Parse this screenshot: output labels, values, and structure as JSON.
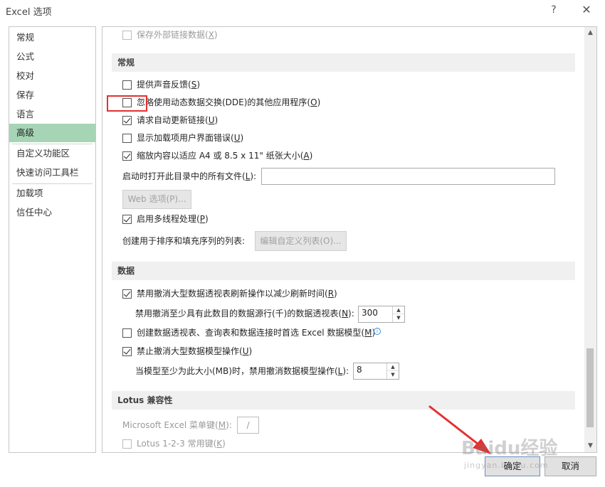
{
  "window": {
    "title": "Excel 选项",
    "help_glyph": "?",
    "close_glyph": "✕"
  },
  "nav": {
    "items": [
      {
        "label": "常规"
      },
      {
        "label": "公式"
      },
      {
        "label": "校对"
      },
      {
        "label": "保存"
      },
      {
        "label": "语言"
      },
      {
        "label": "高级"
      },
      {
        "label": "自定义功能区"
      },
      {
        "label": "快速访问工具栏"
      },
      {
        "label": "加载项"
      },
      {
        "label": "信任中心"
      }
    ],
    "active": "高级"
  },
  "content": {
    "top_option": {
      "pre": "保存外部链接数据(",
      "key": "X",
      "post": ")",
      "checked": false,
      "enabled": false
    },
    "general": {
      "header": "常规",
      "options": [
        {
          "pre": "提供声音反馈(",
          "key": "S",
          "post": ")",
          "checked": false
        },
        {
          "pre": "忽略使用动态数据交换(DDE)的其他应用程序(",
          "key": "O",
          "post": ")",
          "checked": false
        },
        {
          "pre": "请求自动更新链接(",
          "key": "U",
          "post": ")",
          "checked": true
        },
        {
          "pre": "显示加载项用户界面错误(",
          "key": "U",
          "post": ")",
          "checked": false
        },
        {
          "pre": "缩放内容以适应 A4 或 8.5 x 11\" 纸张大小(",
          "key": "A",
          "post": ")",
          "checked": true
        }
      ],
      "startup_label_pre": "启动时打开此目录中的所有文件(",
      "startup_label_key": "L",
      "startup_label_post": "):",
      "startup_value": "",
      "web_options_button": "Web 选项(P)...",
      "multithread": {
        "pre": "启用多线程处理(",
        "key": "P",
        "post": ")",
        "checked": true
      },
      "custom_list_label": "创建用于排序和填充序列的列表:",
      "custom_list_button": "编辑自定义列表(O)..."
    },
    "data": {
      "header": "数据",
      "disable_undo_pivot": {
        "pre": "禁用撤消大型数据透视表刷新操作以减少刷新时间(",
        "key": "R",
        "post": ")",
        "checked": true
      },
      "pivot_rows_label_pre": "禁用撤消至少具有此数目的数据源行(千)的数据透视表(",
      "pivot_rows_label_key": "N",
      "pivot_rows_label_post": "):",
      "pivot_rows_value": "300",
      "default_model": {
        "pre": "创建数据透视表、查询表和数据连接时首选 Excel 数据模型(",
        "key": "M",
        "post": ")",
        "checked": false
      },
      "info_glyph": "i",
      "disable_undo_model": {
        "pre": "禁止撤消大型数据模型操作(",
        "key": "U",
        "post": ")",
        "checked": true
      },
      "model_size_label_pre": "当模型至少为此大小(MB)时，禁用撤消数据模型操作(",
      "model_size_label_key": "L",
      "model_size_label_post": "):",
      "model_size_value": "8"
    },
    "lotus": {
      "header": "Lotus 兼容性",
      "menu_key_label_pre": "Microsoft Excel 菜单键(",
      "menu_key_label_key": "M",
      "menu_key_label_post": "):",
      "menu_key_value": "/",
      "lotus_keys": {
        "pre": "Lotus 1-2-3 常用键(",
        "key": "K",
        "post": ")",
        "checked": false,
        "enabled": false
      }
    }
  },
  "footer": {
    "ok_label": "确定",
    "cancel_label": "取消"
  },
  "watermark": {
    "text": "Baidu经验",
    "sub": "jingyan.baidu.com"
  },
  "annotation_color": "#e53030",
  "accent_color": "#a6d5b6"
}
